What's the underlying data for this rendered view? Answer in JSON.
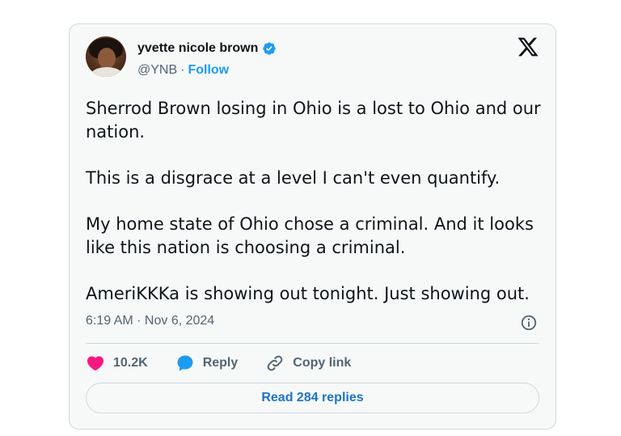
{
  "author": {
    "name": "yvette nicole brown",
    "handle": "@YNB",
    "separator": "·",
    "follow_label": "Follow"
  },
  "tweet": {
    "paragraphs": [
      "Sherrod Brown losing in Ohio is a lost to Ohio and our nation.",
      "This is a disgrace at a level I can't even quantify.",
      "My home state of Ohio chose a criminal. And it looks like this nation is choosing a criminal.",
      "AmeriKKKa is showing out tonight. Just showing out."
    ],
    "timestamp": "6:19 AM · Nov 6, 2024"
  },
  "actions": {
    "like_count": "10.2K",
    "reply_label": "Reply",
    "copy_link_label": "Copy link"
  },
  "read_replies_label": "Read 284 replies",
  "icons": {
    "verified": "verified-badge-icon",
    "brand": "x-logo-icon",
    "info": "info-icon",
    "like": "heart-icon",
    "reply": "speech-bubble-icon",
    "copy_link": "link-icon"
  },
  "colors": {
    "accent": "#1d9bf0",
    "like": "#f91880",
    "muted": "#536471",
    "border": "#cfd9de"
  }
}
